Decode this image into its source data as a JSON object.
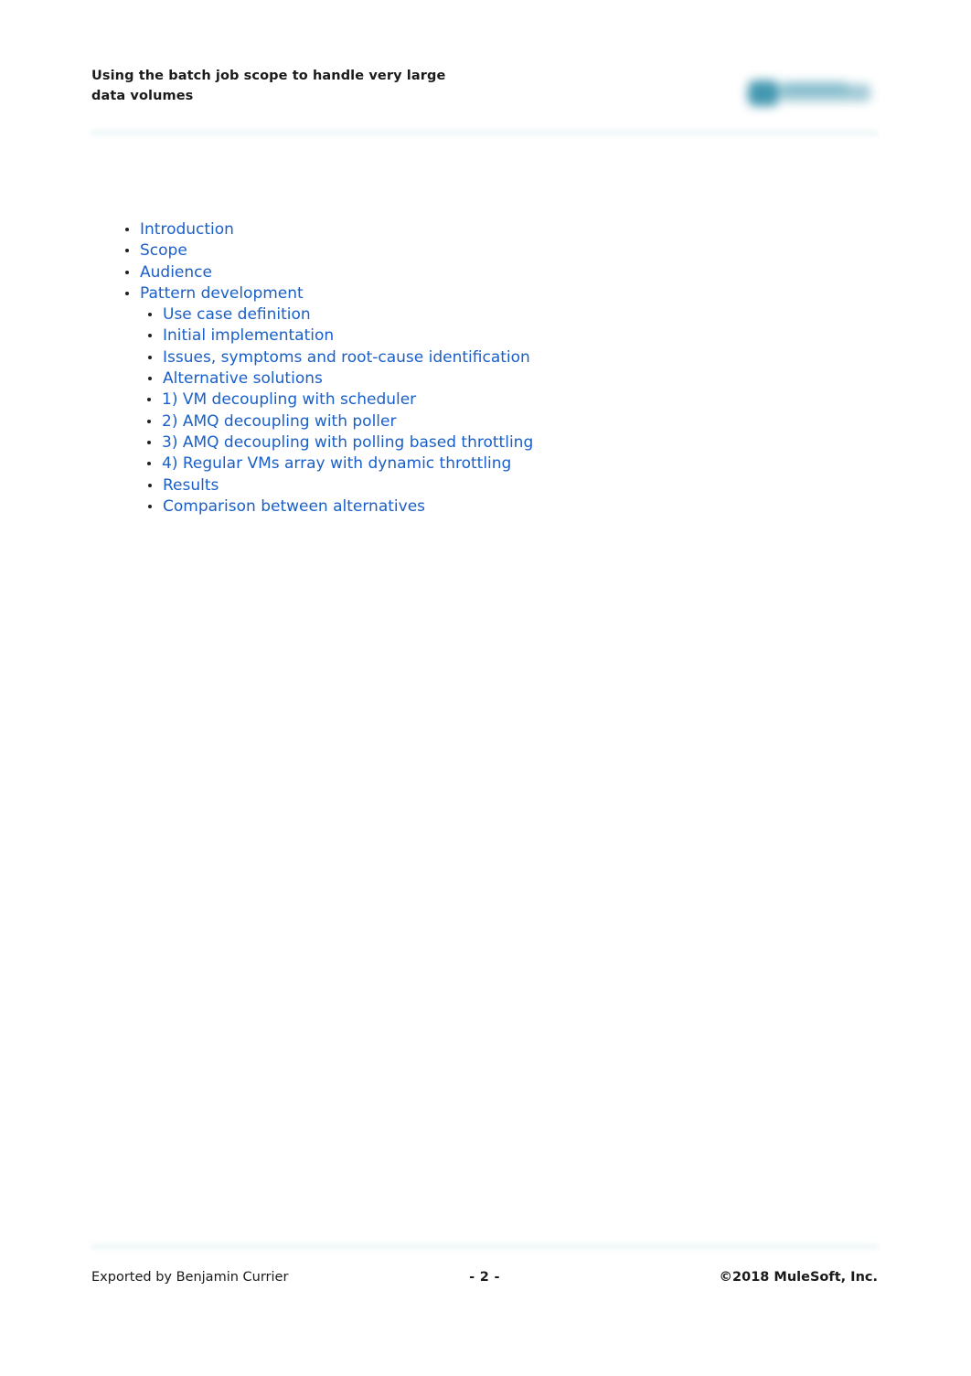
{
  "document": {
    "title_line1": "Using the batch job scope to handle very large",
    "title_line2": "data volumes",
    "logo_name": "mulesoft-logo"
  },
  "toc": {
    "items": [
      {
        "label": "Introduction",
        "level": 1
      },
      {
        "label": "Scope",
        "level": 1
      },
      {
        "label": "Audience",
        "level": 1
      },
      {
        "label": "Pattern development",
        "level": 1
      },
      {
        "label": "Use case definition",
        "level": 2
      },
      {
        "label": "Initial implementation",
        "level": 2
      },
      {
        "label": "Issues, symptoms and root-cause identification",
        "level": 2
      },
      {
        "label": "Alternative solutions",
        "level": 2
      },
      {
        "label": "1) VM decoupling with scheduler",
        "level": 3
      },
      {
        "label": "2) AMQ decoupling with poller",
        "level": 3
      },
      {
        "label": "3) AMQ decoupling with polling based throttling",
        "level": 3
      },
      {
        "label": "4) Regular VMs array with dynamic throttling",
        "level": 3
      },
      {
        "label": "Results",
        "level": 2
      },
      {
        "label": "Comparison between alternatives",
        "level": 2
      }
    ]
  },
  "footer": {
    "exported_by": "Exported by Benjamin Currier",
    "page_number": "- 2 -",
    "copyright": "©2018 MuleSoft, Inc."
  },
  "colors": {
    "link": "#1a5fc8",
    "text": "#1a1a1a",
    "rule": "#e3f0f2",
    "logo_teal": "#3b93ad"
  }
}
